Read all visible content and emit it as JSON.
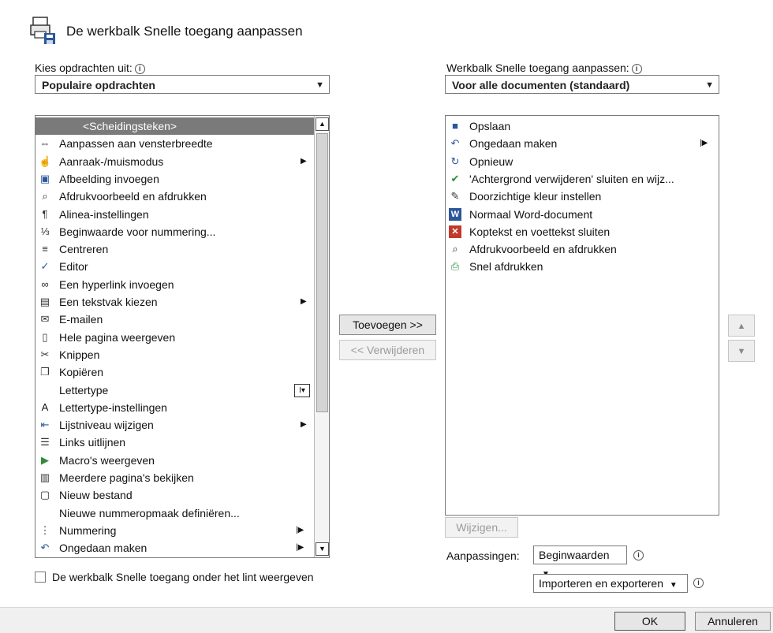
{
  "dialog": {
    "title": "De werkbalk Snelle toegang aanpassen"
  },
  "left": {
    "label": "Kies opdrachten uit:",
    "info": "i",
    "dropdown_value": "Populaire opdrachten",
    "items": [
      {
        "label": "<Scheidingsteken>",
        "icon": "",
        "submenu": false,
        "selected": true
      },
      {
        "label": "Aanpassen aan vensterbreedte",
        "icon": "fit-width-icon",
        "submenu": false
      },
      {
        "label": "Aanraak-/muismodus",
        "icon": "touch-mouse-icon",
        "submenu": true
      },
      {
        "label": "Afbeelding invoegen",
        "icon": "insert-image-icon",
        "submenu": false
      },
      {
        "label": "Afdrukvoorbeeld en afdrukken",
        "icon": "print-preview-icon",
        "submenu": false
      },
      {
        "label": "Alinea-instellingen",
        "icon": "paragraph-icon",
        "submenu": false
      },
      {
        "label": "Beginwaarde voor nummering...",
        "icon": "numbering-value-icon",
        "submenu": false
      },
      {
        "label": "Centreren",
        "icon": "center-align-icon",
        "submenu": false
      },
      {
        "label": "Editor",
        "icon": "editor-icon",
        "submenu": false
      },
      {
        "label": "Een hyperlink invoegen",
        "icon": "hyperlink-icon",
        "submenu": false
      },
      {
        "label": "Een tekstvak kiezen",
        "icon": "textbox-icon",
        "submenu": true
      },
      {
        "label": "E-mailen",
        "icon": "email-icon",
        "submenu": false
      },
      {
        "label": "Hele pagina weergeven",
        "icon": "whole-page-icon",
        "submenu": false
      },
      {
        "label": "Knippen",
        "icon": "scissors-icon",
        "submenu": false
      },
      {
        "label": "Kopiëren",
        "icon": "copy-icon",
        "submenu": false
      },
      {
        "label": "Lettertype",
        "icon": "",
        "submenu": false,
        "font_box": true
      },
      {
        "label": "Lettertype-instellingen",
        "icon": "font-settings-icon",
        "submenu": false
      },
      {
        "label": "Lijstniveau wijzigen",
        "icon": "list-level-icon",
        "submenu": true
      },
      {
        "label": "Links uitlijnen",
        "icon": "align-left-icon",
        "submenu": false
      },
      {
        "label": "Macro's weergeven",
        "icon": "play-macro-icon",
        "submenu": false
      },
      {
        "label": "Meerdere pagina's bekijken",
        "icon": "multi-page-icon",
        "submenu": false
      },
      {
        "label": "Nieuw bestand",
        "icon": "new-file-icon",
        "submenu": false
      },
      {
        "label": "Nieuwe nummeropmaak definiëren...",
        "icon": "",
        "submenu": false
      },
      {
        "label": "Nummering",
        "icon": "numbering-icon",
        "submenu": false,
        "split": true
      },
      {
        "label": "Ongedaan maken",
        "icon": "undo-icon",
        "submenu": false,
        "split": true
      }
    ],
    "show_below_ribbon": "De werkbalk Snelle toegang onder het lint weergeven"
  },
  "middle": {
    "add_button": "Toevoegen >>",
    "remove_button": "<< Verwijderen"
  },
  "right": {
    "label": "Werkbalk Snelle toegang aanpassen:",
    "info": "i",
    "dropdown_value": "Voor alle documenten (standaard)",
    "items": [
      {
        "label": "Opslaan",
        "icon": "save-icon"
      },
      {
        "label": "Ongedaan maken",
        "icon": "undo-icon",
        "split": true
      },
      {
        "label": "Opnieuw",
        "icon": "redo-icon"
      },
      {
        "label": "'Achtergrond verwijderen' sluiten en wijz...",
        "icon": "checkmark-icon"
      },
      {
        "label": "Doorzichtige kleur instellen",
        "icon": "transparent-color-icon"
      },
      {
        "label": "Normaal Word-document",
        "icon": "word-icon"
      },
      {
        "label": "Koptekst en voettekst sluiten",
        "icon": "close-header-footer-icon"
      },
      {
        "label": "Afdrukvoorbeeld en afdrukken",
        "icon": "print-preview-icon"
      },
      {
        "label": "Snel afdrukken",
        "icon": "quick-print-icon"
      }
    ],
    "modify_button": "Wijzigen...",
    "customizations_label": "Aanpassingen:",
    "reset_button": "Beginwaarden",
    "import_export_button": "Importeren en exporteren",
    "move_up": "▲",
    "move_down": "▼"
  },
  "footer": {
    "ok": "OK",
    "cancel": "Annuleren"
  },
  "colors": {
    "selected_row": "#7a7a7a",
    "word_blue": "#2b579a",
    "close_red": "#c0392b",
    "check_green": "#2e8b3a"
  }
}
